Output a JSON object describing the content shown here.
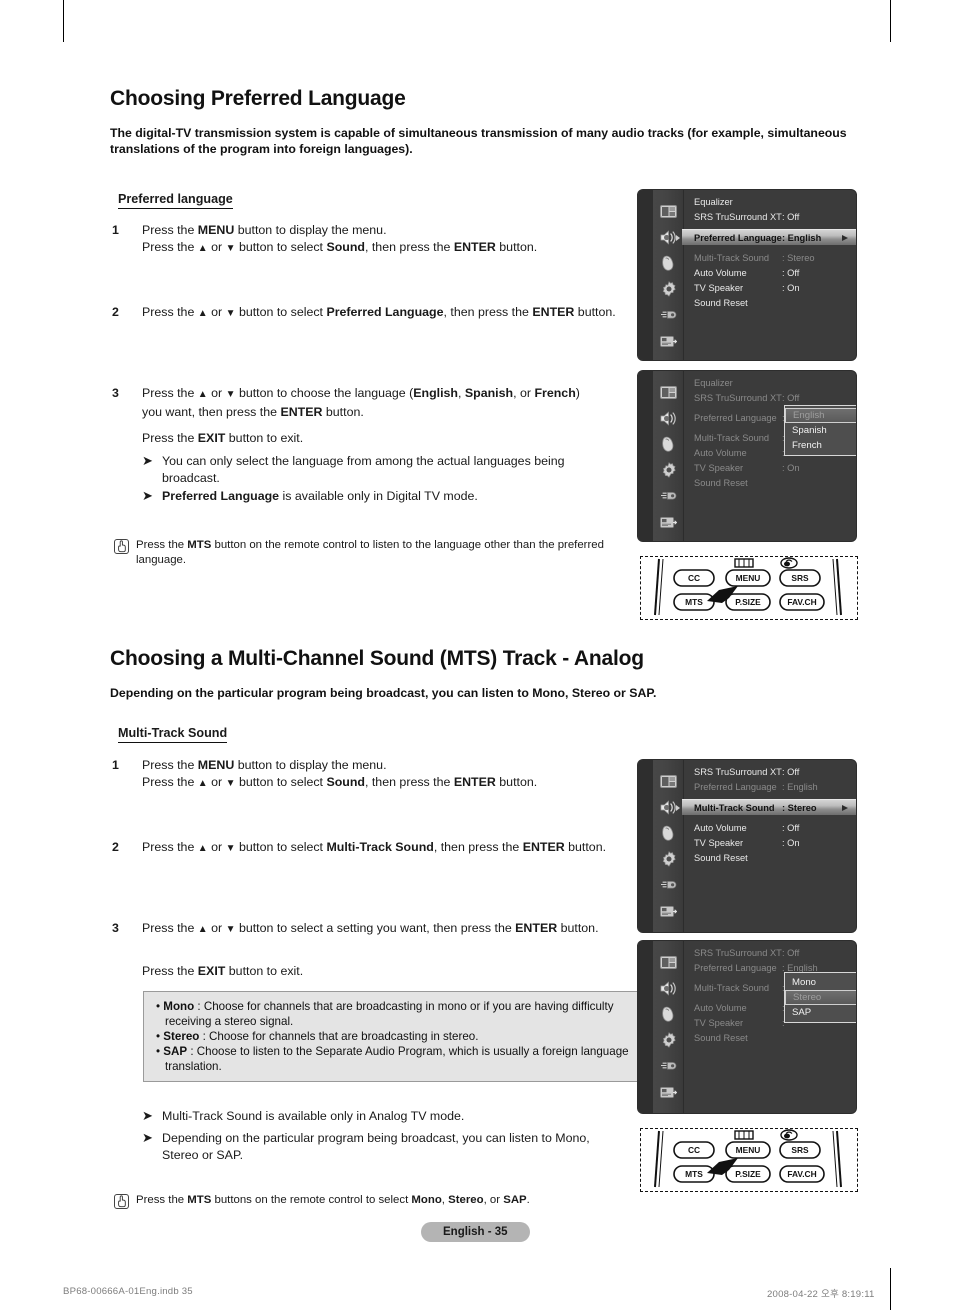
{
  "document": {
    "section1": {
      "title": "Choosing Preferred Language",
      "intro": "The digital-TV transmission system is capable of simultaneous transmission of many audio tracks (for example, simultaneous translations of the program into foreign languages).",
      "sub_head": "Preferred language",
      "steps": [
        {
          "num": "1",
          "line1_a": "Press the ",
          "line1_b": "MENU",
          "line1_c": " button to display the menu.",
          "line2_a": "Press the ",
          "line2_up": "▲",
          "line2_b": " or ",
          "line2_dn": "▼",
          "line2_c": " button to select ",
          "line2_d": "Sound",
          "line2_e": ", then press the ",
          "line2_f": "ENTER",
          "line2_g": " button."
        },
        {
          "num": "2",
          "line1_a": "Press the ",
          "line1_up": "▲",
          "line1_b": " or ",
          "line1_dn": "▼",
          "line1_c": " button to select ",
          "line1_d": "Preferred Language",
          "line1_e": ", then press the ",
          "line1_f": "ENTER",
          "line1_g": " button."
        },
        {
          "num": "3",
          "line1_a": "Press the ",
          "line1_up": "▲",
          "line1_b": " or ",
          "line1_dn": "▼",
          "line1_c": " button to choose the language (",
          "lang1": "English",
          "sep1": ", ",
          "lang2": "Spanish",
          "sep2": ", or ",
          "lang3": "French",
          "close": ")",
          "line2_a": "you want, then press the ",
          "line2_b": "ENTER",
          "line2_c": " button.",
          "exit_a": "Press the ",
          "exit_b": "EXIT",
          "exit_c": " button to exit."
        }
      ],
      "bullets": [
        {
          "plain": "You can only select the language from among the actual languages being broadcast."
        },
        {
          "bold": "Preferred Language",
          "rest": " is available only in Digital TV mode."
        }
      ],
      "note": {
        "a": "Press the ",
        "b": "MTS",
        "c": " button on the remote control to listen to the language other than the preferred language.",
        "icon": "hand-pointer-icon"
      }
    },
    "section2": {
      "title": "Choosing a Multi-Channel Sound (MTS) Track - Analog",
      "intro": "Depending on the particular program being broadcast, you can listen to Mono, Stereo or SAP.",
      "sub_head": "Multi-Track Sound",
      "steps": [
        {
          "num": "1",
          "line1_a": "Press the ",
          "line1_b": "MENU",
          "line1_c": " button to display the menu.",
          "line2_a": "Press the ",
          "line2_up": "▲",
          "line2_b": " or ",
          "line2_dn": "▼",
          "line2_c": " button to select ",
          "line2_d": "Sound",
          "line2_e": ", then press the ",
          "line2_f": "ENTER",
          "line2_g": " button."
        },
        {
          "num": "2",
          "line1_a": "Press the ",
          "line1_up": "▲",
          "line1_b": " or ",
          "line1_dn": "▼",
          "line1_c": " button to select ",
          "line1_d": "Multi-Track Sound",
          "line1_e": ", then press the ",
          "line1_f": "ENTER",
          "line1_g": " button."
        },
        {
          "num": "3",
          "line1_a": "Press the ",
          "line1_up": "▲",
          "line1_b": " or ",
          "line1_dn": "▼",
          "line1_c": " button to select a setting you want, then press the ",
          "line1_f": "ENTER",
          "line1_g": " button.",
          "exit_a": "Press the ",
          "exit_b": "EXIT",
          "exit_c": " button to exit."
        }
      ],
      "grey_box": [
        {
          "bold": "Mono",
          "rest": " : Choose for channels that are broadcasting in mono or if you are having difficulty receiving a stereo signal."
        },
        {
          "bold": "Stereo",
          "rest": " : Choose for channels that are broadcasting in stereo."
        },
        {
          "bold": "SAP",
          "rest": " : Choose to listen to the Separate Audio Program, which is usually a foreign language translation."
        }
      ],
      "bullets": [
        {
          "plain": "Multi-Track Sound is available only in Analog TV mode."
        },
        {
          "plain": "Depending on the particular program being broadcast, you can listen to Mono, Stereo or SAP."
        }
      ],
      "note": {
        "a": "Press the ",
        "b": "MTS",
        "c": " buttons on the remote control to select ",
        "d": "Mono",
        "e": ", ",
        "f": "Stereo",
        "g": ", or ",
        "h": "SAP",
        "i": ".",
        "icon": "hand-pointer-icon"
      }
    },
    "footer": {
      "page_tag": "English - 35",
      "file_meta": "BP68-00666A-01Eng.indb   35",
      "date_meta": "2008-04-22   오후 8:19:11"
    }
  },
  "osd_menus": [
    {
      "id": "menu-preferred-language",
      "tab_label": "Sound",
      "icons": [
        "picture-icon",
        "sound-speaker-icon",
        "setup-remote-icon",
        "settings-gear-icon",
        "input-plug-icon",
        "card-slot-icon"
      ],
      "selected_icon_index": 1,
      "rows": [
        {
          "label": "Equalizer",
          "value": "",
          "state": "normal"
        },
        {
          "label": "SRS TruSurround XT",
          "value": ": Off",
          "state": "normal"
        },
        {
          "label": "Preferred Language",
          "value": ": English",
          "state": "highlight"
        },
        {
          "label": "Multi-Track Sound",
          "value": ": Stereo",
          "state": "dim"
        },
        {
          "label": "Auto Volume",
          "value": ": Off",
          "state": "normal"
        },
        {
          "label": "TV Speaker",
          "value": ": On",
          "state": "normal"
        },
        {
          "label": "Sound Reset",
          "value": "",
          "state": "normal"
        }
      ]
    },
    {
      "id": "menu-language-popup",
      "tab_label": "Sound",
      "icons": [
        "picture-icon",
        "sound-speaker-icon",
        "setup-remote-icon",
        "settings-gear-icon",
        "input-plug-icon",
        "card-slot-icon"
      ],
      "selected_icon_index": 1,
      "rows": [
        {
          "label": "Equalizer",
          "value": "",
          "state": "dim"
        },
        {
          "label": "SRS TruSurround XT",
          "value": ": Off",
          "state": "dim"
        },
        {
          "label": "Preferred Language",
          "value": ":",
          "state": "dim"
        },
        {
          "label": "Multi-Track Sound",
          "value": ":",
          "state": "dim"
        },
        {
          "label": "Auto Volume",
          "value": ":",
          "state": "dim"
        },
        {
          "label": "TV Speaker",
          "value": ": On",
          "state": "dim"
        },
        {
          "label": "Sound Reset",
          "value": "",
          "state": "dim"
        }
      ],
      "popup": {
        "items": [
          "English",
          "Spanish",
          "French"
        ],
        "selected": "English"
      }
    },
    {
      "id": "menu-multi-track-sound",
      "tab_label": "Sound",
      "icons": [
        "picture-icon",
        "sound-speaker-icon",
        "setup-remote-icon",
        "settings-gear-icon",
        "input-plug-icon",
        "card-slot-icon"
      ],
      "selected_icon_index": 1,
      "rows": [
        {
          "label": "SRS TruSurround XT",
          "value": ": Off",
          "state": "normal"
        },
        {
          "label": "Preferred Language",
          "value": ": English",
          "state": "dim"
        },
        {
          "label": "Multi-Track Sound",
          "value": ": Stereo",
          "state": "highlight"
        },
        {
          "label": "Auto Volume",
          "value": ": Off",
          "state": "normal"
        },
        {
          "label": "TV Speaker",
          "value": ": On",
          "state": "normal"
        },
        {
          "label": "Sound Reset",
          "value": "",
          "state": "normal"
        }
      ]
    },
    {
      "id": "menu-mts-popup",
      "tab_label": "Sound",
      "icons": [
        "picture-icon",
        "sound-speaker-icon",
        "setup-remote-icon",
        "settings-gear-icon",
        "input-plug-icon",
        "card-slot-icon"
      ],
      "selected_icon_index": 1,
      "rows": [
        {
          "label": "SRS TruSurround XT",
          "value": ": Off",
          "state": "dim"
        },
        {
          "label": "Preferred Language",
          "value": ": English",
          "state": "dim"
        },
        {
          "label": "Multi-Track Sound",
          "value": ":",
          "state": "dim"
        },
        {
          "label": "Auto Volume",
          "value": ":",
          "state": "dim"
        },
        {
          "label": "TV Speaker",
          "value": ":",
          "state": "dim"
        },
        {
          "label": "Sound Reset",
          "value": "",
          "state": "dim"
        }
      ],
      "popup": {
        "items": [
          "Mono",
          "Stereo",
          "SAP"
        ],
        "selected": "Stereo"
      }
    }
  ],
  "remotes": [
    {
      "id": "remote-figure-top",
      "buttons": [
        "CC",
        "MENU",
        "SRS",
        "MTS",
        "P.SIZE",
        "FAV.CH"
      ],
      "pointer_target": "MTS"
    },
    {
      "id": "remote-figure-bottom",
      "buttons": [
        "CC",
        "MENU",
        "SRS",
        "MTS",
        "P.SIZE",
        "FAV.CH"
      ],
      "pointer_target": "MTS"
    }
  ]
}
